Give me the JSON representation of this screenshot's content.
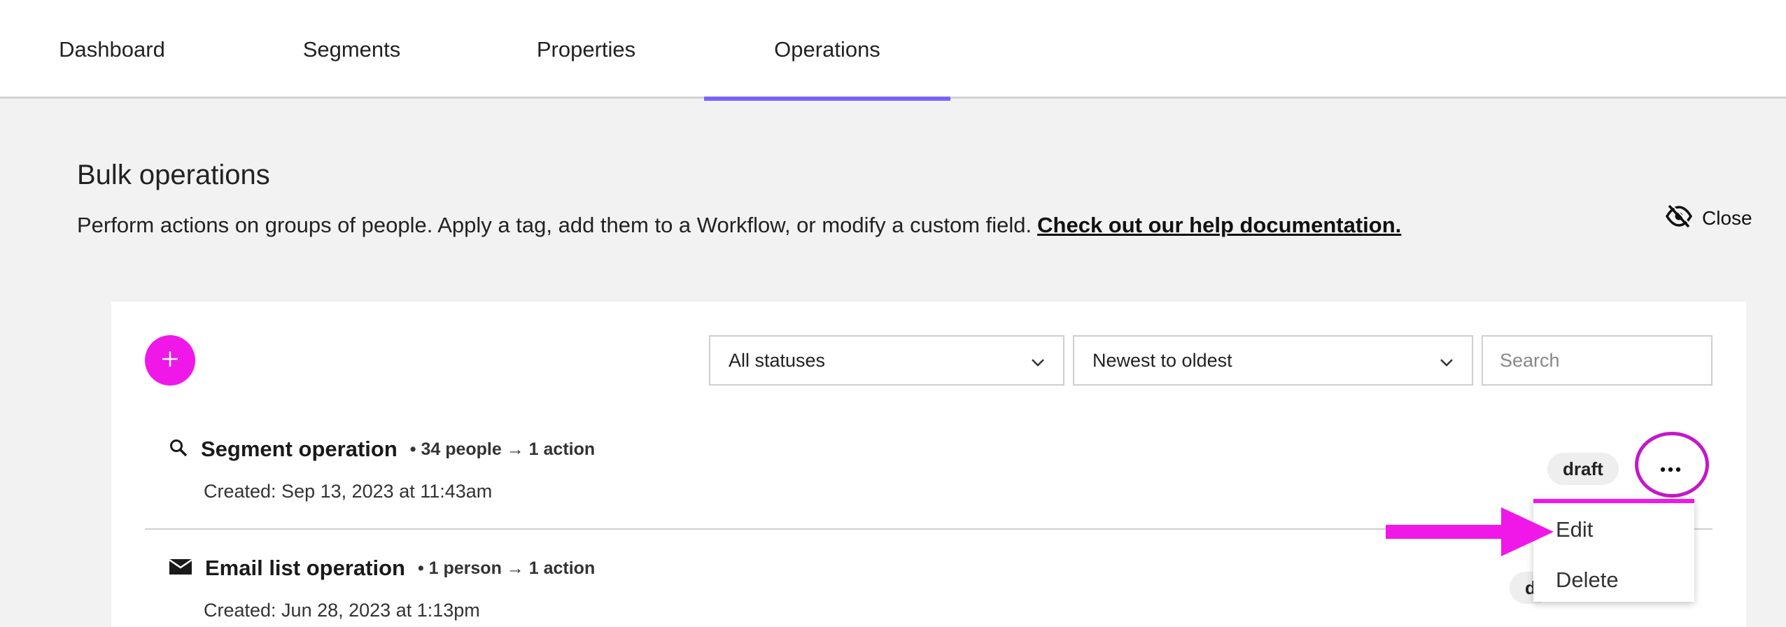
{
  "nav": {
    "tabs": [
      {
        "label": "Dashboard"
      },
      {
        "label": "Segments"
      },
      {
        "label": "Properties"
      },
      {
        "label": "Operations",
        "active": true
      }
    ]
  },
  "header": {
    "title": "Bulk operations",
    "description": "Perform actions on groups of people. Apply a tag, add them to a Workflow, or modify a custom field.",
    "help_link": "Check out our help documentation.",
    "close_label": "Close"
  },
  "toolbar": {
    "status_filter": "All statuses",
    "sort": "Newest to oldest",
    "search_placeholder": "Search"
  },
  "operations": [
    {
      "icon": "search-icon",
      "name": "Segment operation",
      "meta": "• 34 people → 1 action",
      "created": "Created: Sep 13, 2023 at 11:43am",
      "status": "draft"
    },
    {
      "icon": "envelope-icon",
      "name": "Email list operation",
      "meta": "• 1 person → 1 action",
      "created": "Created: Jun 28, 2023 at 1:13pm",
      "status": "d"
    }
  ],
  "menu": {
    "edit": "Edit",
    "delete": "Delete"
  },
  "colors": {
    "accent": "#7b61ff",
    "brand": "#f018e8",
    "highlight": "#c418c8"
  }
}
